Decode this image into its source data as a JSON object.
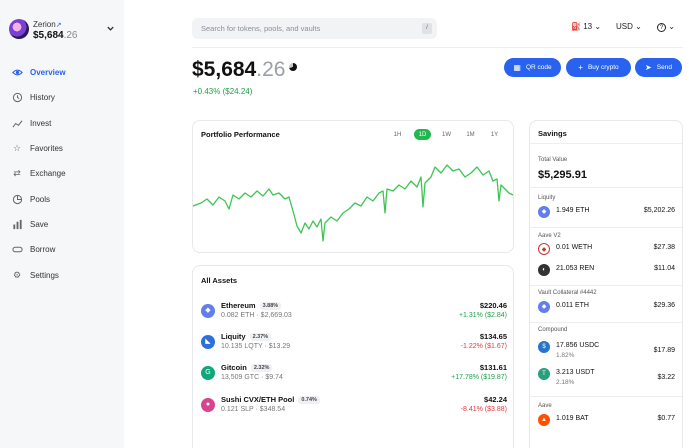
{
  "account": {
    "name": "Zerion",
    "ext_mark": "↗",
    "balance_int": "$5,684",
    "balance_dec": ".26"
  },
  "sidebar": {
    "items": [
      {
        "label": "Overview",
        "icon": "eye-icon",
        "active": true
      },
      {
        "label": "History",
        "icon": "history-icon"
      },
      {
        "label": "Invest",
        "icon": "invest-chart-icon"
      },
      {
        "label": "Favorites",
        "icon": "star-icon"
      },
      {
        "label": "Exchange",
        "icon": "exchange-icon"
      },
      {
        "label": "Pools",
        "icon": "pools-icon"
      },
      {
        "label": "Save",
        "icon": "save-bars-icon"
      },
      {
        "label": "Borrow",
        "icon": "borrow-icon"
      },
      {
        "label": "Settings",
        "icon": "gear-icon"
      }
    ]
  },
  "header": {
    "search_placeholder": "Search for tokens, pools, and vaults",
    "search_key": "/",
    "gas": "13",
    "currency": "USD",
    "help": "?"
  },
  "balance": {
    "int": "$5,684",
    "dec": ".26",
    "change": "+0.43% ($24.24)"
  },
  "actions": {
    "qr": "QR code",
    "buy": "Buy crypto",
    "send": "Send"
  },
  "performance": {
    "title": "Portfolio Performance",
    "timeframes": [
      "1H",
      "1D",
      "1W",
      "1M",
      "1Y"
    ],
    "active_timeframe": "1D"
  },
  "assets": {
    "title": "All Assets",
    "items": [
      {
        "name": "Ethereum",
        "pct": "3.88%",
        "sub": "0.082 ETH · $2,669.03",
        "value": "$220.46",
        "change": "+1.31% ($2.84)",
        "dir": "up",
        "color": "#627eea"
      },
      {
        "name": "Liquity",
        "pct": "2.37%",
        "sub": "10.135 LQTY · $13.29",
        "value": "$134.65",
        "change": "-1.22% ($1.67)",
        "dir": "down",
        "color": "#2f6fdc"
      },
      {
        "name": "Gitcoin",
        "pct": "2.32%",
        "sub": "13,509 GTC · $9.74",
        "value": "$131.61",
        "change": "+17.78% ($19.87)",
        "dir": "up",
        "color": "#0fa87a"
      },
      {
        "name": "Sushi CVX/ETH Pool",
        "pct": "0.74%",
        "sub": "0.121 SLP · $348.54",
        "value": "$42.24",
        "change": "-8.41% ($3.88)",
        "dir": "down",
        "color": "#d6458d"
      }
    ]
  },
  "savings": {
    "title": "Savings",
    "total_label": "Total Value",
    "total": "$5,295.91",
    "liquity_label": "Liquity",
    "liquity_row": {
      "name": "1.949 ETH",
      "value": "$5,202.26"
    },
    "aave_v2_label": "Aave V2",
    "aave_rows": [
      {
        "name": "0.01 WETH",
        "value": "$27.38"
      },
      {
        "name": "21.053 REN",
        "value": "$11.04"
      }
    ],
    "vault_label": "Vault Collateral #4442",
    "vault_row": {
      "name": "0.011 ETH",
      "value": "$29.36"
    },
    "compound_label": "Compound",
    "compound_rows": [
      {
        "name": "17.856 USDC",
        "sub": "1.82%",
        "value": "$17.89"
      },
      {
        "name": "3.213 USDT",
        "sub": "2.18%",
        "value": "$3.22"
      }
    ],
    "aave_label": "Aave",
    "aave_row": {
      "name": "1.019 BAT",
      "value": "$0.77"
    }
  },
  "colors": {
    "accent": "#2962ef",
    "positive": "#1fa04a",
    "negative": "#e23b3b",
    "chart_line": "#3cc553"
  }
}
